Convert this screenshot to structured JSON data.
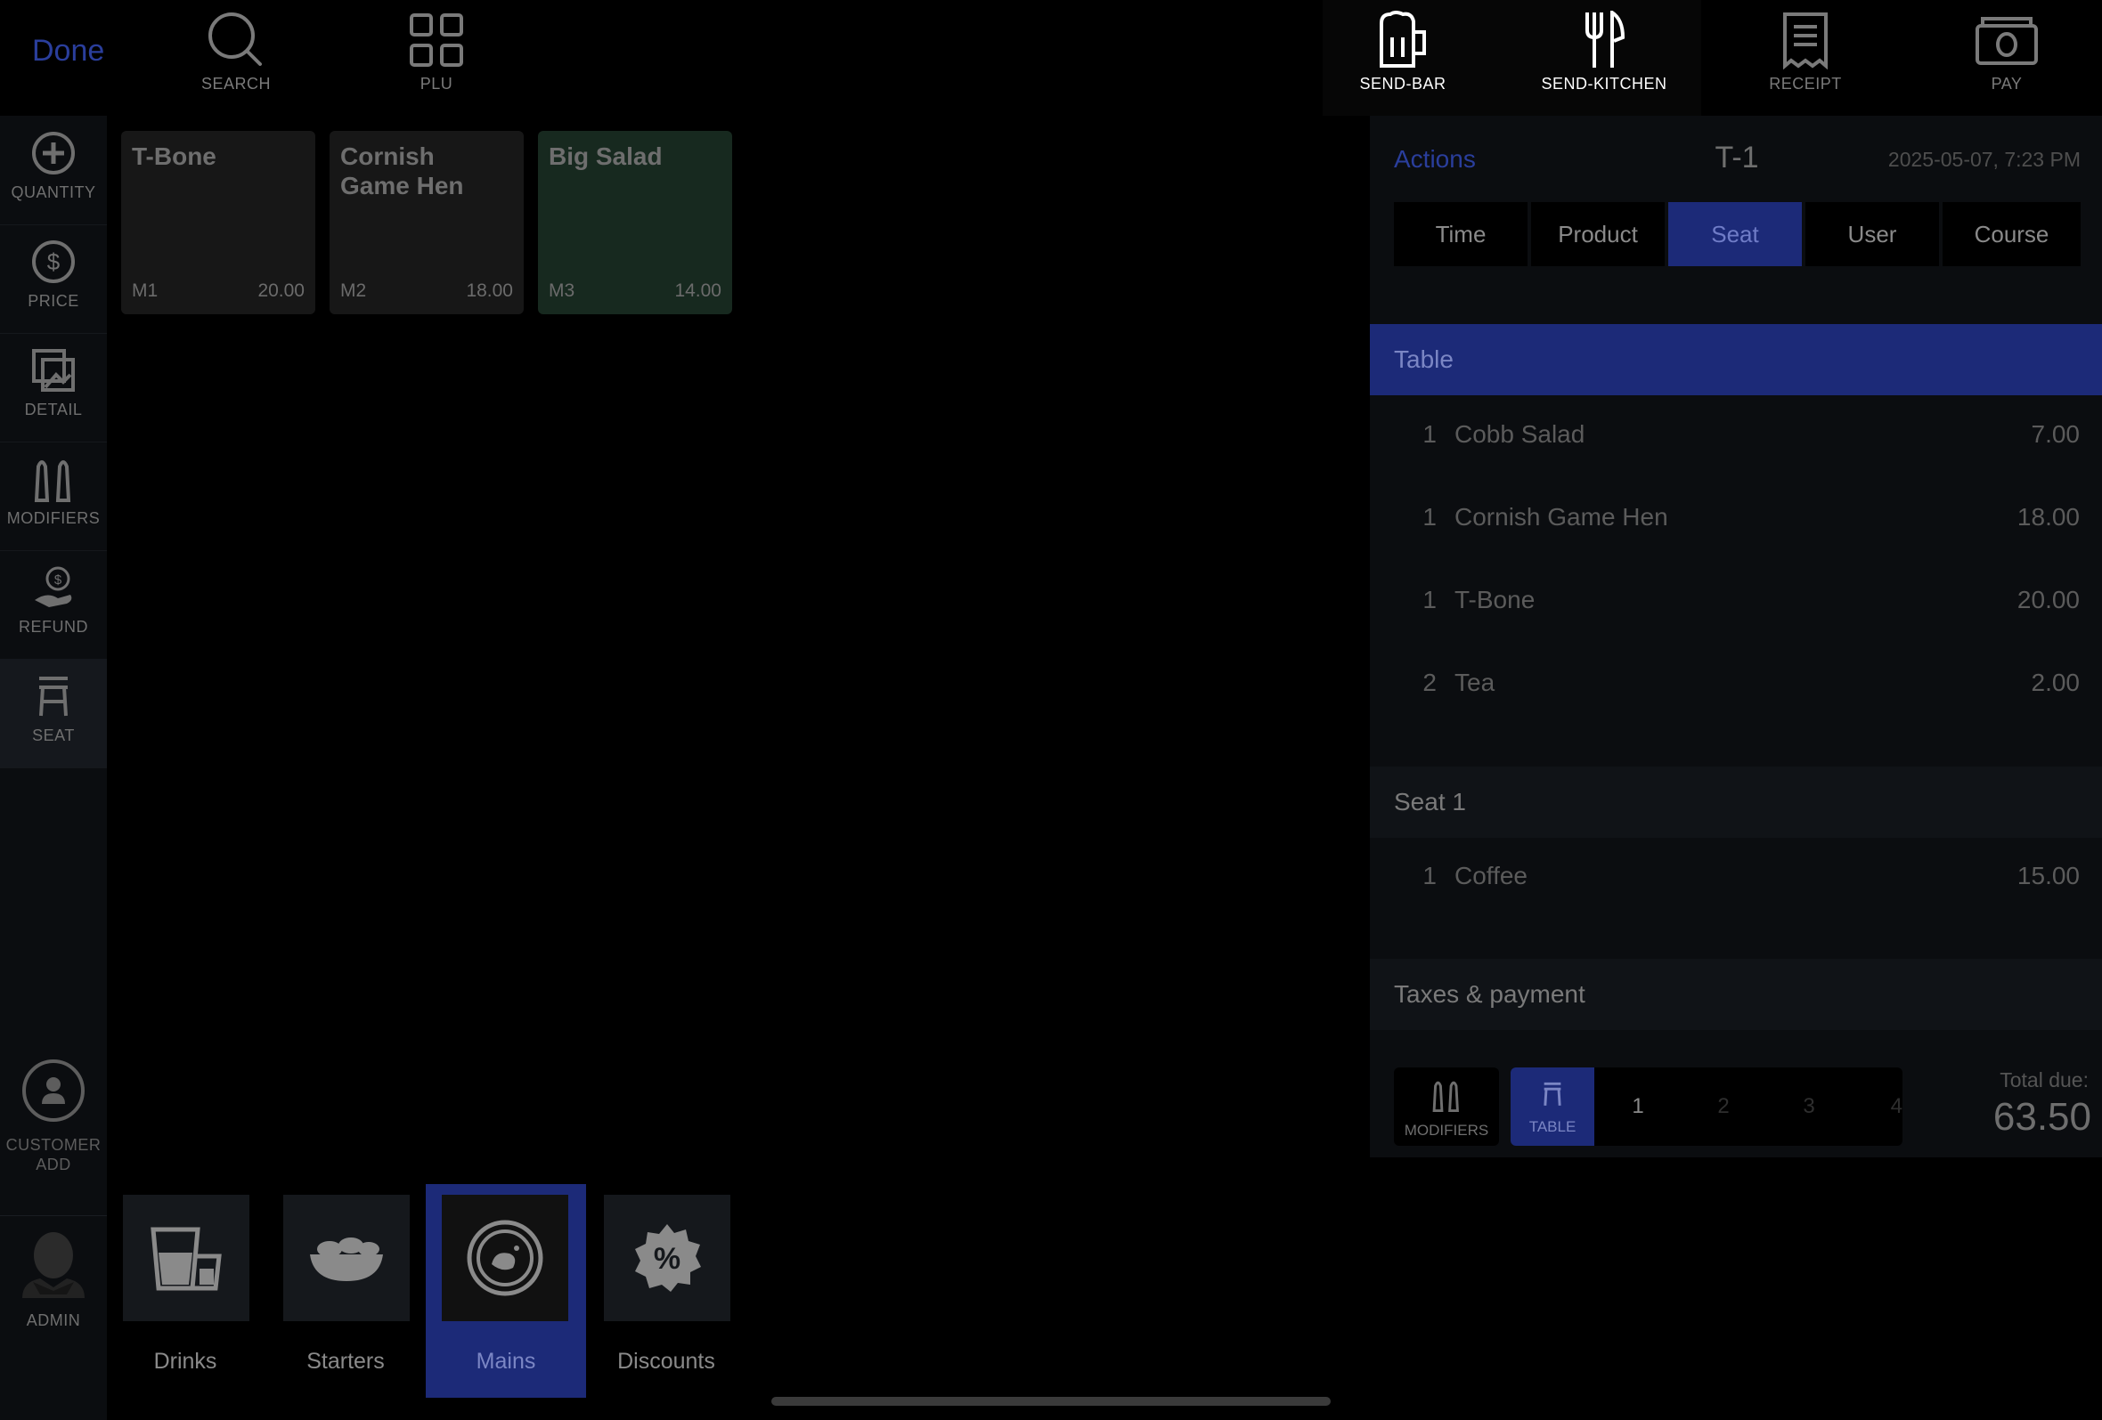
{
  "topbar": {
    "done_label": "Done",
    "buttons": [
      {
        "label": "SEARCH",
        "icon": "magnifier-icon"
      },
      {
        "label": "PLU",
        "icon": "grid-icon"
      },
      {
        "label": "SEND-BAR",
        "icon": "beer-mug-icon"
      },
      {
        "label": "SEND-KITCHEN",
        "icon": "fork-knife-icon"
      },
      {
        "label": "RECEIPT",
        "icon": "receipt-icon"
      },
      {
        "label": "PAY",
        "icon": "cash-icon"
      }
    ]
  },
  "leftrail": {
    "items": [
      {
        "label": "QUANTITY",
        "icon": "plus-circle-icon"
      },
      {
        "label": "PRICE",
        "icon": "dollar-circle-icon"
      },
      {
        "label": "DETAIL",
        "icon": "photo-stack-icon"
      },
      {
        "label": "MODIFIERS",
        "icon": "salt-pepper-icon"
      },
      {
        "label": "REFUND",
        "icon": "hand-coin-icon"
      },
      {
        "label": "SEAT",
        "icon": "stool-icon"
      }
    ],
    "customer_line1": "CUSTOMER",
    "customer_line2": "ADD",
    "admin_label": "ADMIN"
  },
  "products": [
    {
      "name": "T-Bone",
      "code": "M1",
      "price": "20.00"
    },
    {
      "name": "Cornish Game Hen",
      "code": "M2",
      "price": "18.00"
    },
    {
      "name": "Big Salad",
      "code": "M3",
      "price": "14.00"
    }
  ],
  "categories": [
    {
      "label": "Drinks",
      "icon": "drinks-glass-icon"
    },
    {
      "label": "Starters",
      "icon": "salad-bowl-icon"
    },
    {
      "label": "Mains",
      "icon": "plate-icon",
      "selected": true
    },
    {
      "label": "Discounts",
      "icon": "percent-badge-icon"
    }
  ],
  "order": {
    "actions_label": "Actions",
    "table_id": "T-1",
    "timestamp": "2025-05-07, 7:23 PM",
    "group_tabs": [
      "Time",
      "Product",
      "Seat",
      "User",
      "Course"
    ],
    "selected_group": "Seat",
    "sections": [
      {
        "title": "Table",
        "items": [
          {
            "qty": "1",
            "name": "Cobb Salad",
            "price": "7.00"
          },
          {
            "qty": "1",
            "name": "Cornish Game Hen",
            "price": "18.00"
          },
          {
            "qty": "1",
            "name": "T-Bone",
            "price": "20.00"
          },
          {
            "qty": "2",
            "name": "Tea",
            "price": "2.00"
          }
        ]
      },
      {
        "title": "Seat 1",
        "items": [
          {
            "qty": "1",
            "name": "Coffee",
            "price": "15.00"
          }
        ]
      }
    ],
    "taxes_label": "Taxes & payment",
    "modifiers_label": "MODIFIERS",
    "seat_selector": {
      "table_label": "TABLE",
      "seats": [
        "1",
        "2",
        "3",
        "4"
      ]
    },
    "total_label": "Total due:",
    "total_value": "63.50"
  },
  "colors": {
    "accent_blue": "#1c2a78",
    "link_blue": "#2a3e9c",
    "background": "#000000",
    "panel": "#0b0d10"
  }
}
